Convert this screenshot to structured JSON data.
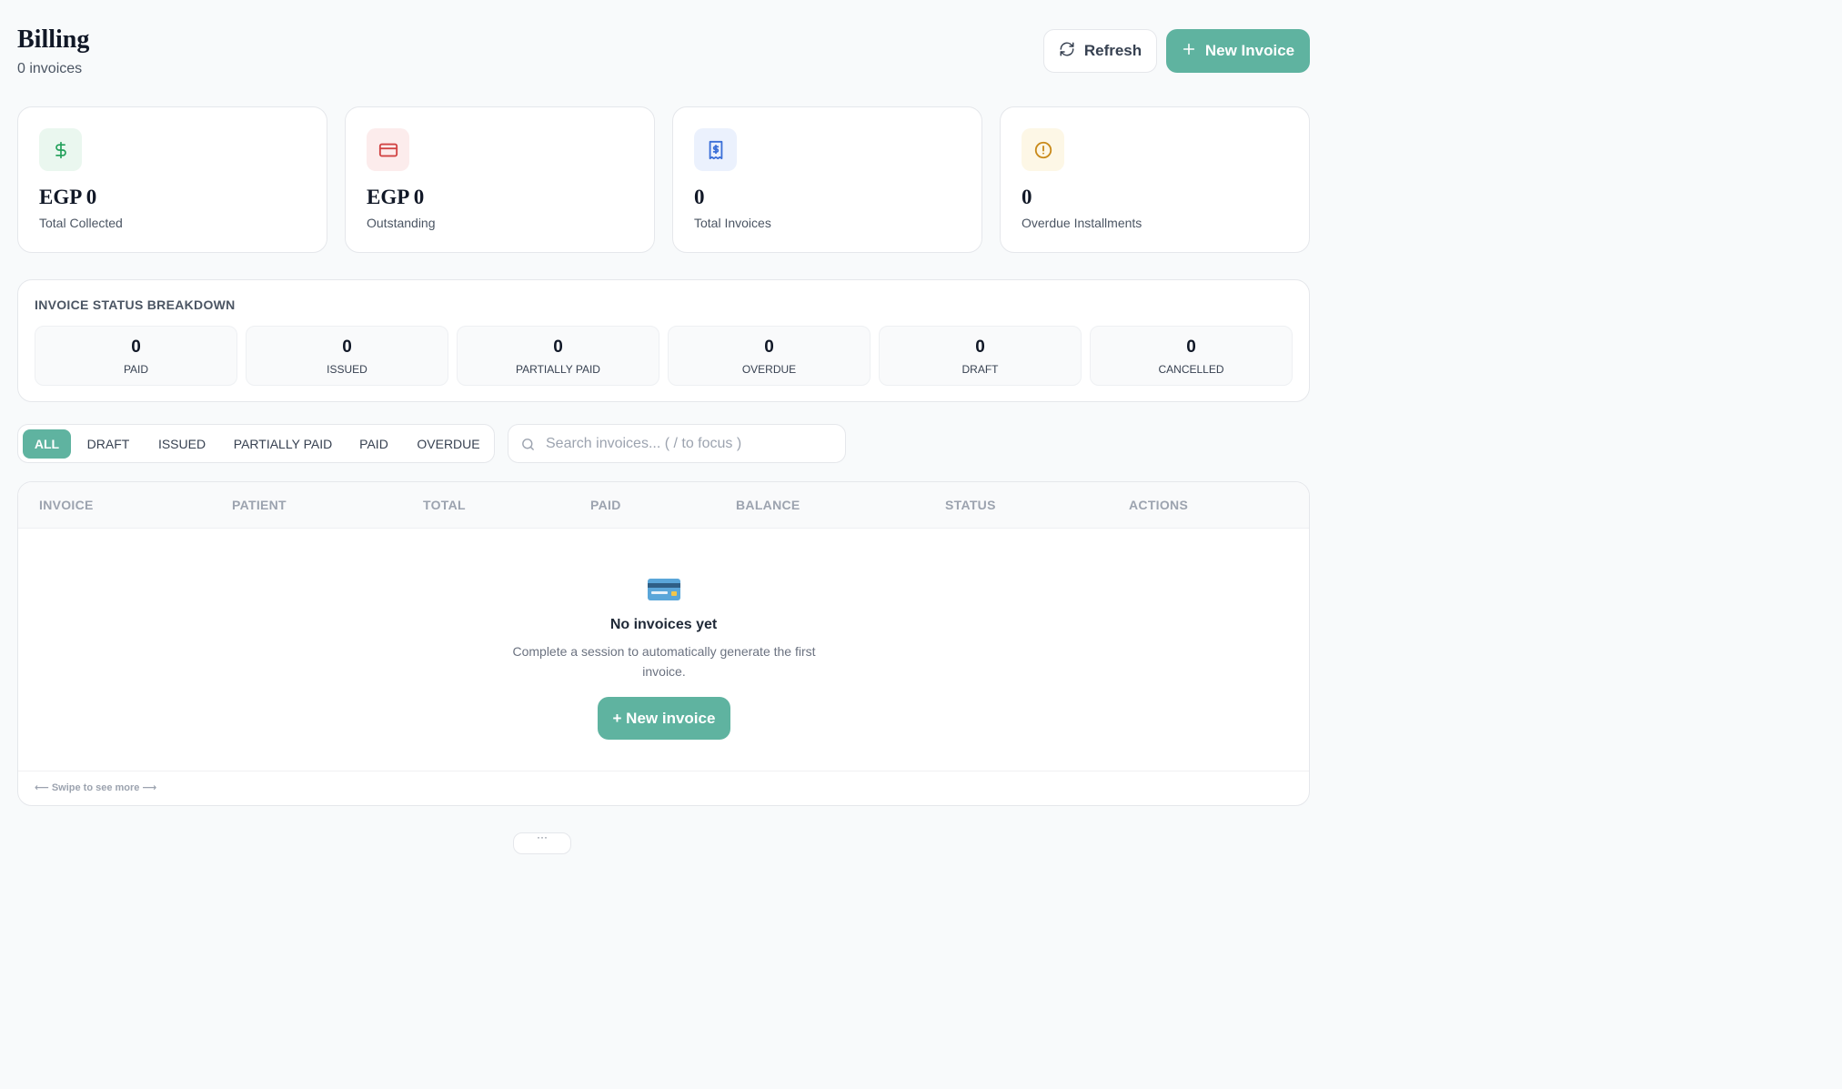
{
  "header": {
    "title": "Billing",
    "subtitle": "0 invoices",
    "refresh_label": "Refresh",
    "new_invoice_label": "New Invoice"
  },
  "stats": [
    {
      "value": "EGP 0",
      "label": "Total Collected",
      "icon": "dollar-icon",
      "icon_color": "#22a05a",
      "bg": "#eaf7ef"
    },
    {
      "value": "EGP 0",
      "label": "Outstanding",
      "icon": "credit-card-icon",
      "icon_color": "#d14343",
      "bg": "#fcecec"
    },
    {
      "value": "0",
      "label": "Total Invoices",
      "icon": "receipt-icon",
      "icon_color": "#3b6fd8",
      "bg": "#ebf1fd"
    },
    {
      "value": "0",
      "label": "Overdue Installments",
      "icon": "alert-circle-icon",
      "icon_color": "#c98a1a",
      "bg": "#fdf7e6"
    }
  ],
  "breakdown": {
    "title": "INVOICE STATUS BREAKDOWN",
    "items": [
      {
        "value": "0",
        "label": "PAID"
      },
      {
        "value": "0",
        "label": "ISSUED"
      },
      {
        "value": "0",
        "label": "PARTIALLY PAID"
      },
      {
        "value": "0",
        "label": "OVERDUE"
      },
      {
        "value": "0",
        "label": "DRAFT"
      },
      {
        "value": "0",
        "label": "CANCELLED"
      }
    ]
  },
  "filters": {
    "tabs": [
      "ALL",
      "DRAFT",
      "ISSUED",
      "PARTIALLY PAID",
      "PAID",
      "OVERDUE"
    ],
    "active": "ALL"
  },
  "search": {
    "placeholder": "Search invoices... ( / to focus )",
    "value": ""
  },
  "table": {
    "columns": [
      "INVOICE",
      "PATIENT",
      "TOTAL",
      "PAID",
      "BALANCE",
      "STATUS",
      "ACTIONS"
    ],
    "rows": [],
    "empty": {
      "title": "No invoices yet",
      "description": "Complete a session to automatically generate the first invoice.",
      "button_label": "+ New invoice",
      "icon": "credit-card-icon"
    },
    "swipe_hint": "⟵ Swipe to see more ⟶"
  },
  "colors": {
    "accent": "#5fb3a0"
  },
  "bottom_handle": "···"
}
